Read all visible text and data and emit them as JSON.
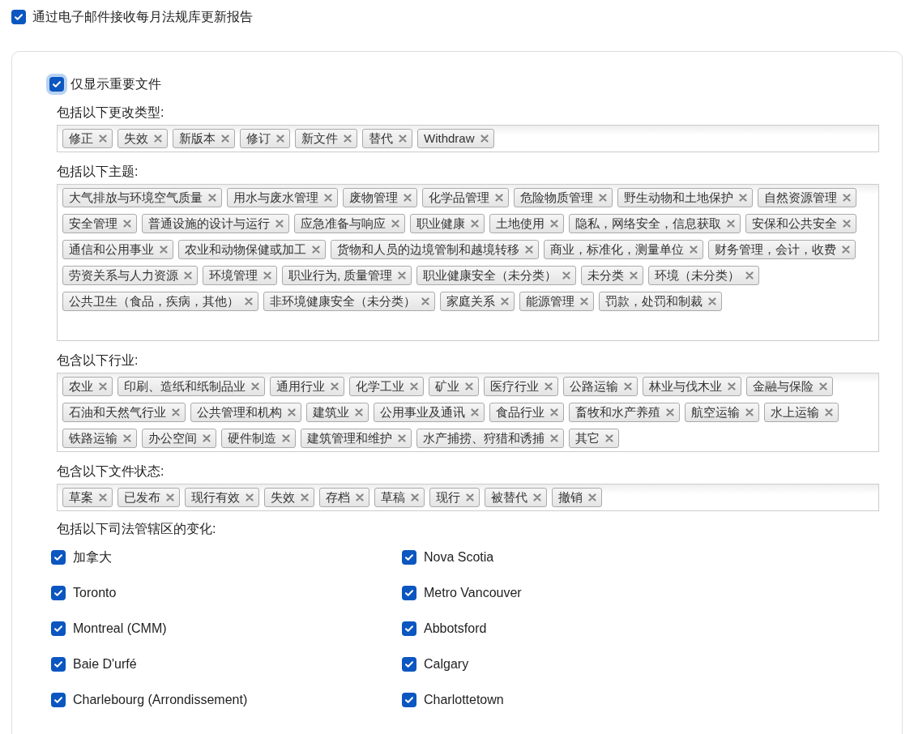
{
  "email_report": {
    "label": "通过电子邮件接收每月法规库更新报告",
    "checked": true
  },
  "only_important": {
    "label": "仅显示重要文件",
    "checked": true,
    "focused": true
  },
  "tag_groups": [
    {
      "label": "包括以下更改类型:",
      "tags": [
        "修正",
        "失效",
        "新版本",
        "修订",
        "新文件",
        "替代",
        "Withdraw"
      ]
    },
    {
      "label": "包括以下主题:",
      "tags": [
        "大气排放与环境空气质量",
        "用水与废水管理",
        "废物管理",
        "化学品管理",
        "危险物质管理",
        "野生动物和土地保护",
        "自然资源管理",
        "安全管理",
        "普通设施的设计与运行",
        "应急准备与响应",
        "职业健康",
        "土地使用",
        "隐私，网络安全，信息获取",
        "安保和公共安全",
        "通信和公用事业",
        "农业和动物保健或加工",
        "货物和人员的边境管制和越境转移",
        "商业，标准化，测量单位",
        "财务管理，会计，收费",
        "劳资关系与人力资源",
        "环境管理",
        "职业行为, 质量管理",
        "职业健康安全（未分类）",
        "未分类",
        "环境（未分类）",
        "公共卫生（食品，疾病，其他）",
        "非环境健康安全（未分类）",
        "家庭关系",
        "能源管理",
        "罚款，处罚和制裁"
      ]
    },
    {
      "label": "包含以下行业:",
      "tags": [
        "农业",
        "印刷、造纸和纸制品业",
        "通用行业",
        "化学工业",
        "矿业",
        "医疗行业",
        "公路运输",
        "林业与伐木业",
        "金融与保险",
        "石油和天然气行业",
        "公共管理和机构",
        "建筑业",
        "公用事业及通讯",
        "食品行业",
        "畜牧和水产养殖",
        "航空运输",
        "水上运输",
        "铁路运输",
        "办公空间",
        "硬件制造",
        "建筑管理和维护",
        "水产捕捞、狩猎和诱捕",
        "其它"
      ]
    },
    {
      "label": "包含以下文件状态:",
      "tags": [
        "草案",
        "已发布",
        "现行有效",
        "失效",
        "存档",
        "草稿",
        "现行",
        "被替代",
        "撤销"
      ]
    }
  ],
  "jurisdictions": {
    "label": "包括以下司法管辖区的变化:",
    "items": [
      {
        "label": "加拿大",
        "checked": true
      },
      {
        "label": "Nova Scotia",
        "checked": true
      },
      {
        "label": "Toronto",
        "checked": true
      },
      {
        "label": "Metro Vancouver",
        "checked": true
      },
      {
        "label": "Montreal (CMM)",
        "checked": true
      },
      {
        "label": "Abbotsford",
        "checked": true
      },
      {
        "label": "Baie D'urfé",
        "checked": true
      },
      {
        "label": "Calgary",
        "checked": true
      },
      {
        "label": "Charlebourg (Arrondissement)",
        "checked": true
      },
      {
        "label": "Charlottetown",
        "checked": true
      }
    ]
  }
}
